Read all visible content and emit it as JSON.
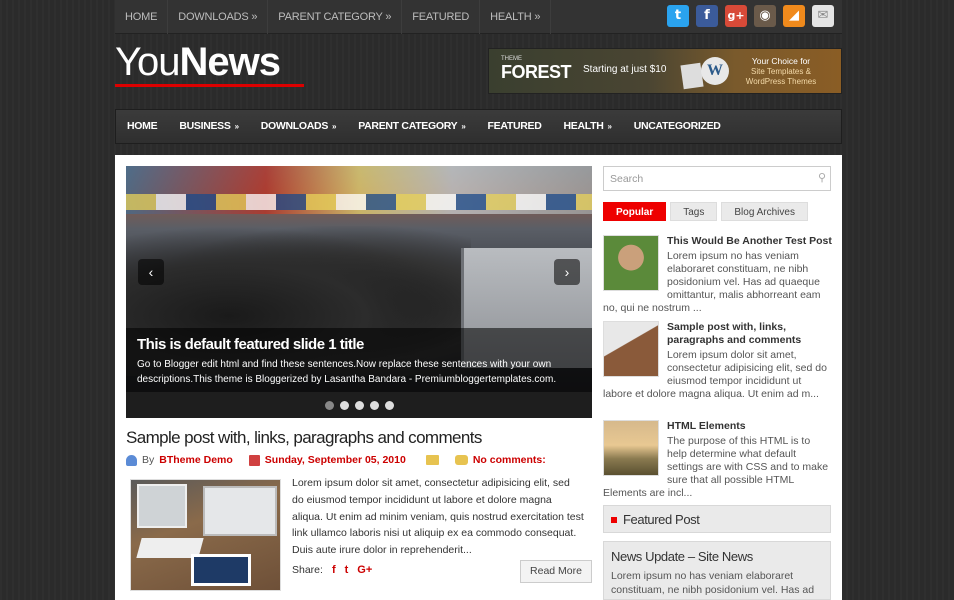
{
  "topnav": {
    "items": [
      "HOME",
      "DOWNLOADS »",
      "PARENT CATEGORY »",
      "FEATURED",
      "HEALTH »"
    ]
  },
  "social": {
    "icons": [
      "twitter-icon",
      "facebook-icon",
      "google-plus-icon",
      "instagram-icon",
      "rss-icon",
      "email-icon"
    ],
    "glyphs": [
      "t",
      "f",
      "g+",
      "◉",
      "◢",
      "✉"
    ],
    "colors": [
      "#2aa3ef",
      "#3b5b9a",
      "#d84a38",
      "#6a5a4a",
      "#f08a1c",
      "#e5e5e5"
    ]
  },
  "logo": {
    "part1": "You",
    "part2": "News"
  },
  "banner": {
    "brand_small": "THEME",
    "brand_big": "FOREST",
    "starting": "Starting at just $10",
    "choice_line1": "Your Choice for",
    "choice_line2": "Site Templates &",
    "choice_line3": "WordPress Themes",
    "wp_glyph": "W"
  },
  "mainnav": {
    "items": [
      {
        "label": "HOME",
        "arrow": ""
      },
      {
        "label": "BUSINESS",
        "arrow": "»"
      },
      {
        "label": "DOWNLOADS",
        "arrow": "»"
      },
      {
        "label": "PARENT CATEGORY",
        "arrow": "»"
      },
      {
        "label": "FEATURED",
        "arrow": ""
      },
      {
        "label": "HEALTH",
        "arrow": "»"
      },
      {
        "label": "UNCATEGORIZED",
        "arrow": ""
      }
    ]
  },
  "slider": {
    "prev": "‹",
    "next": "›",
    "title": "This is default featured slide 1 title",
    "text": "Go to Blogger edit html and find these sentences.Now replace these sentences with your own descriptions.This theme is Bloggerized by Lasantha Bandara - Premiumbloggertemplates.com.",
    "dot_count": 5,
    "active_dot": 0
  },
  "post": {
    "title": "Sample post with, links, paragraphs and comments",
    "by": "By",
    "author": "BTheme Demo",
    "date": "Sunday, September 05, 2010",
    "comments": "No comments:",
    "excerpt": "Lorem ipsum dolor sit amet, consectetur adipisicing elit, sed do eiusmod tempor incididunt ut labore et dolore magna aliqua. Ut enim ad minim veniam, quis nostrud exercitation test link ullamco laboris nisi ut aliquip ex ea commodo consequat. Duis aute irure dolor in reprehenderit...",
    "share_label": "Share:",
    "share_f": "f",
    "share_t": "t",
    "share_g": "G+",
    "read_more": "Read More"
  },
  "sidebar": {
    "search_placeholder": "Search",
    "search_glyph": "⚲",
    "tabs": [
      "Popular",
      "Tags",
      "Blog Archives"
    ],
    "posts": [
      {
        "title": "This Would Be Another Test Post",
        "desc": "Lorem ipsum no has veniam elaboraret constituam, ne nibh posidonium vel. Has ad quaeque omittantur, malis abhorreant eam no, qui ne nostrum ..."
      },
      {
        "title": "Sample post with, links, paragraphs and comments",
        "desc": "Lorem ipsum dolor sit amet, consectetur adipisicing elit, sed do eiusmod tempor incididunt ut labore et dolore magna aliqua. Ut enim ad m..."
      },
      {
        "title": "HTML Elements",
        "desc": "The purpose of this HTML is to help determine what default settings are with CSS and to make sure that all possible HTML Elements are incl..."
      }
    ],
    "featured_heading": "Featured Post",
    "featured_title": "News Update – Site News",
    "featured_desc": "Lorem ipsum no has veniam elaboraret constituam, ne nibh posidonium vel. Has ad"
  }
}
